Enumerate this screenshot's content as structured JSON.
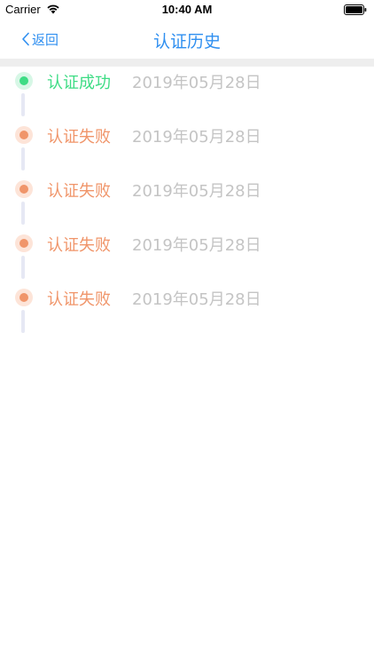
{
  "status_bar": {
    "carrier": "Carrier",
    "time": "10:40 AM",
    "icons": [
      "wifi-icon",
      "battery-icon"
    ]
  },
  "nav": {
    "back_label": "返回",
    "title": "认证历史",
    "accent_color": "#2f8ff0"
  },
  "colors": {
    "success": "#3ddc84",
    "success_halo": "#d7f7e6",
    "failure": "#f0956a",
    "failure_halo": "#fde4d8",
    "date": "#c4c4c4",
    "connector": "#e6e8f4"
  },
  "history": [
    {
      "status": "认证成功",
      "type": "success",
      "date": "2019年05月28日"
    },
    {
      "status": "认证失败",
      "type": "failure",
      "date": "2019年05月28日"
    },
    {
      "status": "认证失败",
      "type": "failure",
      "date": "2019年05月28日"
    },
    {
      "status": "认证失败",
      "type": "failure",
      "date": "2019年05月28日"
    },
    {
      "status": "认证失败",
      "type": "failure",
      "date": "2019年05月28日"
    }
  ]
}
